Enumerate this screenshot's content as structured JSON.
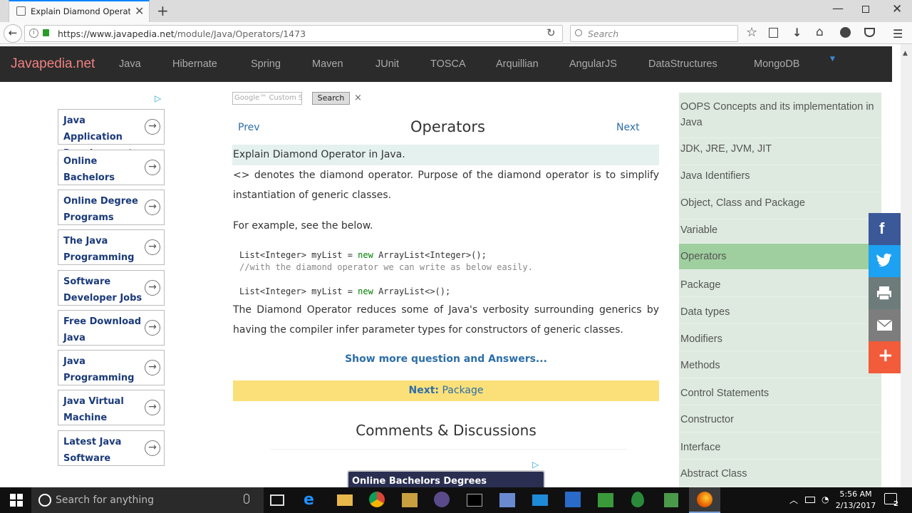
{
  "browser": {
    "tab_title": "Explain Diamond Operator...",
    "url_domain": "https://www.javapedia.net",
    "url_path": "/module/Java/Operators/1473",
    "search_placeholder": "Search"
  },
  "site": {
    "logo": "Javapedia.net",
    "nav": [
      "Java",
      "Hibernate",
      "Spring",
      "Maven",
      "JUnit",
      "TOSCA",
      "Arquillian",
      "AngularJS",
      "DataStructures",
      "MongoDB"
    ]
  },
  "left_ads": [
    "Java Application Development",
    "Online Bachelors",
    "Online Degree Programs",
    "The Java Programming",
    "Software Developer Jobs",
    "Free Download Java",
    "Java Programming",
    "Java Virtual Machine",
    "Latest Java Software"
  ],
  "gsearch": {
    "placeholder": "Google™ Custom Search",
    "button": "Search",
    "close": "×"
  },
  "main": {
    "prev": "Prev",
    "next": "Next",
    "title": "Operators",
    "question": "Explain Diamond Operator in Java.",
    "p1": "<> denotes the diamond operator. Purpose of the diamond operator is to simplify instantiation of generic classes.",
    "p2": "For example, see the below.",
    "code1a": "List<Integer> myList = ",
    "code_kw": "new",
    "code1b": " ArrayList<Integer>();",
    "code_comment": "//with the diamond operator we can write as below easily.",
    "code2a": "List<Integer> myList = ",
    "code2b": " ArrayList<>();",
    "p3": "The Diamond Operator reduces some of Java's verbosity surrounding generics by having the compiler infer parameter types for constructors of generic classes.",
    "show_more": "Show more question and Answers...",
    "next_label": "Next:",
    "next_link": "Package",
    "comments": "Comments & Discussions",
    "ad_banner": "Online Bachelors Degrees"
  },
  "sidebar": [
    "OOPS Concepts and its implementation in Java",
    "JDK, JRE, JVM, JIT",
    "Java Identifiers",
    "Object, Class and Package",
    "Variable",
    "Operators",
    "Package",
    "Data types",
    "Modifiers",
    "Methods",
    "Control Statements",
    "Constructor",
    "Interface",
    "Abstract Class"
  ],
  "sidebar_active": "Operators",
  "share": [
    {
      "icon": "facebook-icon",
      "color": "#3b5998"
    },
    {
      "icon": "twitter-icon",
      "color": "#1da1f2"
    },
    {
      "icon": "print-icon",
      "color": "#6d7b7b"
    },
    {
      "icon": "email-icon",
      "color": "#7d7d7d"
    },
    {
      "icon": "plus-icon",
      "color": "#f25c3b"
    }
  ],
  "taskbar": {
    "search_placeholder": "Search for anything",
    "time": "5:56 AM",
    "date": "2/13/2017",
    "notifications": "2"
  }
}
